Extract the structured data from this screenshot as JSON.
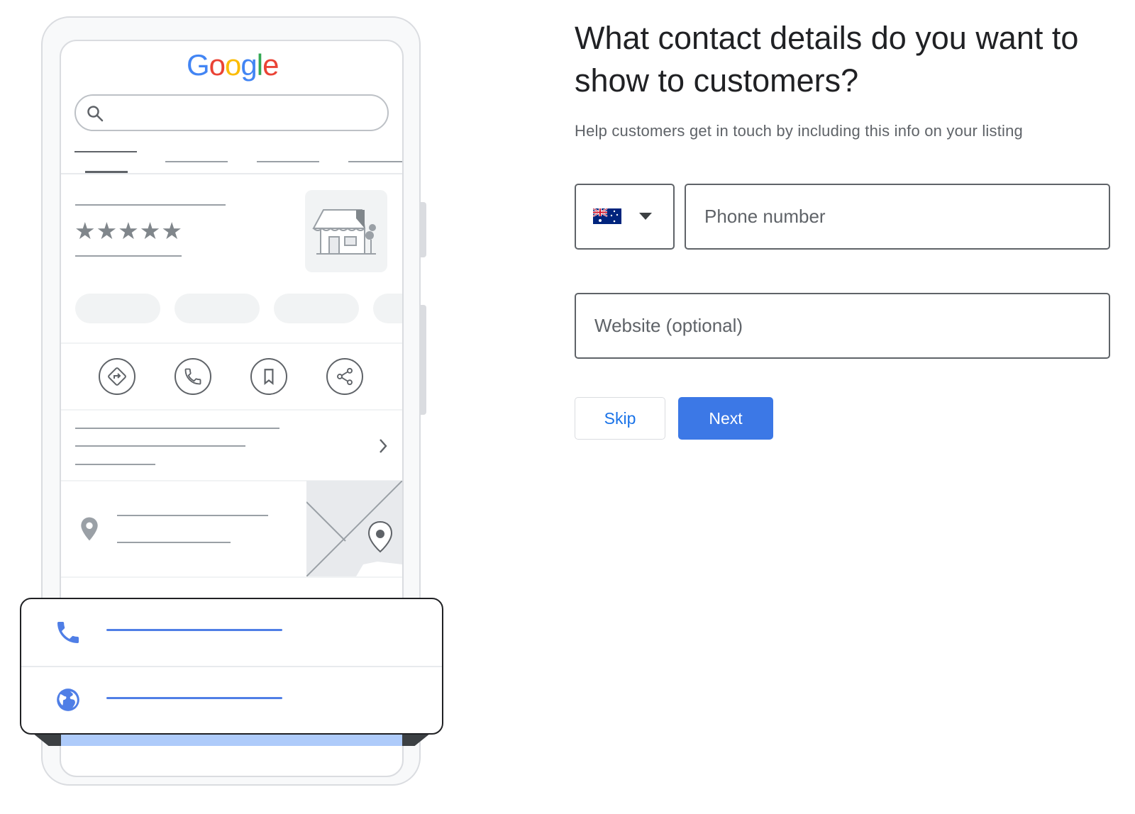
{
  "illustration": {
    "google_logo": [
      {
        "letter": "G",
        "color": "#4285F4"
      },
      {
        "letter": "o",
        "color": "#EA4335"
      },
      {
        "letter": "o",
        "color": "#FBBC05"
      },
      {
        "letter": "g",
        "color": "#4285F4"
      },
      {
        "letter": "l",
        "color": "#34A853"
      },
      {
        "letter": "e",
        "color": "#EA4335"
      }
    ],
    "rating_stars": "★★★★★",
    "action_icons": [
      "directions-icon",
      "phone-icon",
      "bookmark-icon",
      "share-icon"
    ],
    "popup_icons": [
      "phone-icon",
      "globe-icon"
    ],
    "accent_color": "#4f7ee6"
  },
  "form": {
    "title": "What contact details do you want to show to customers?",
    "subtitle": "Help customers get in touch by including this info on your listing",
    "country_flag": "AU",
    "phone_placeholder": "Phone number",
    "phone_value": "",
    "website_placeholder": "Website (optional)",
    "website_value": "",
    "skip_label": "Skip",
    "next_label": "Next",
    "primary_color": "#3c78e6"
  }
}
